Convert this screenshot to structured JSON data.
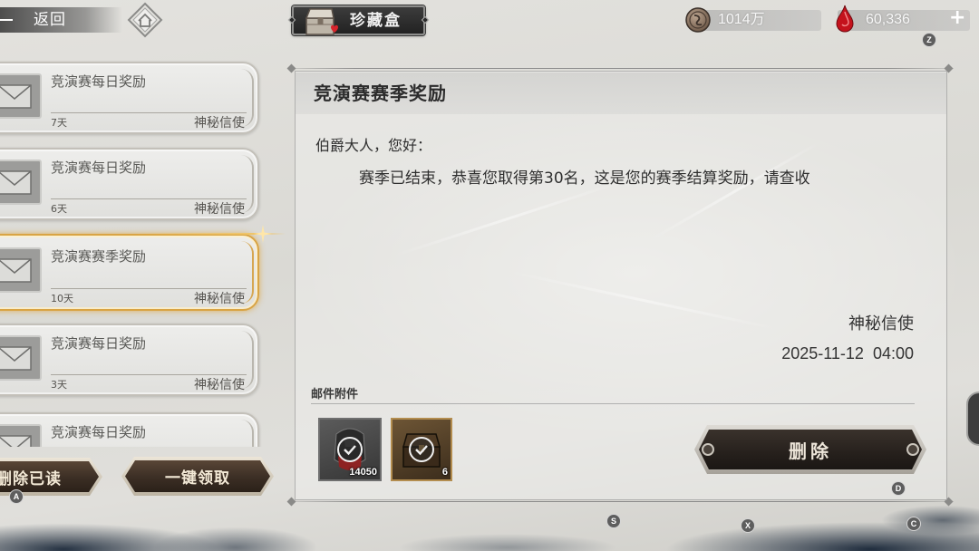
{
  "top_bar": {
    "back_label": "返回",
    "back_icon": "back-arrow-icon",
    "home_icon": "home-icon",
    "collection": {
      "label": "珍藏盒",
      "icon": "treasure-chest-icon"
    },
    "currencies": [
      {
        "icon": "coin-icon",
        "value": "1014万"
      },
      {
        "icon": "red-gem-icon",
        "value": "60,336",
        "add_label": "+"
      }
    ],
    "hotkey": "Z"
  },
  "mail_list": [
    {
      "title": "竞演赛每日奖励",
      "days": "7天",
      "sender": "神秘信使",
      "icon": "envelope-icon"
    },
    {
      "title": "竞演赛每日奖励",
      "days": "6天",
      "sender": "神秘信使",
      "icon": "envelope-icon"
    },
    {
      "title": "竞演赛赛季奖励",
      "days": "10天",
      "sender": "神秘信使",
      "icon": "envelope-icon",
      "selected": true
    },
    {
      "title": "竞演赛每日奖励",
      "days": "3天",
      "sender": "神秘信使",
      "icon": "envelope-icon"
    },
    {
      "title": "竞演赛每日奖励",
      "icon": "envelope-icon"
    }
  ],
  "list_actions": {
    "delete_read_label": "删除已读",
    "claim_all_label": "一键领取",
    "hotkey": "A"
  },
  "mail_detail": {
    "title": "竞演赛赛季奖励",
    "greeting": "伯爵大人，您好：",
    "body": "赛季已结束，恭喜您取得第30名，这是您的赛季结算奖励，请查收",
    "signature": "神秘信使",
    "date": "2025-11-12  04:00",
    "attachments_label": "邮件附件",
    "attachments": [
      {
        "icon": "armor-item-icon",
        "count": "14050",
        "claimed": true
      },
      {
        "icon": "treasure-chest-item-icon",
        "count": "6",
        "claimed": true
      }
    ],
    "delete_label": "删除",
    "hotkey": "D"
  },
  "footer_hotkeys": [
    "S",
    "X",
    "C"
  ],
  "colors": {
    "selected_border": "#d9a444",
    "button_dark": "#2c2520",
    "button_frame": "#d2c9b8",
    "gem_red": "#c4121c",
    "ink_blue": "#1b2a3c"
  }
}
